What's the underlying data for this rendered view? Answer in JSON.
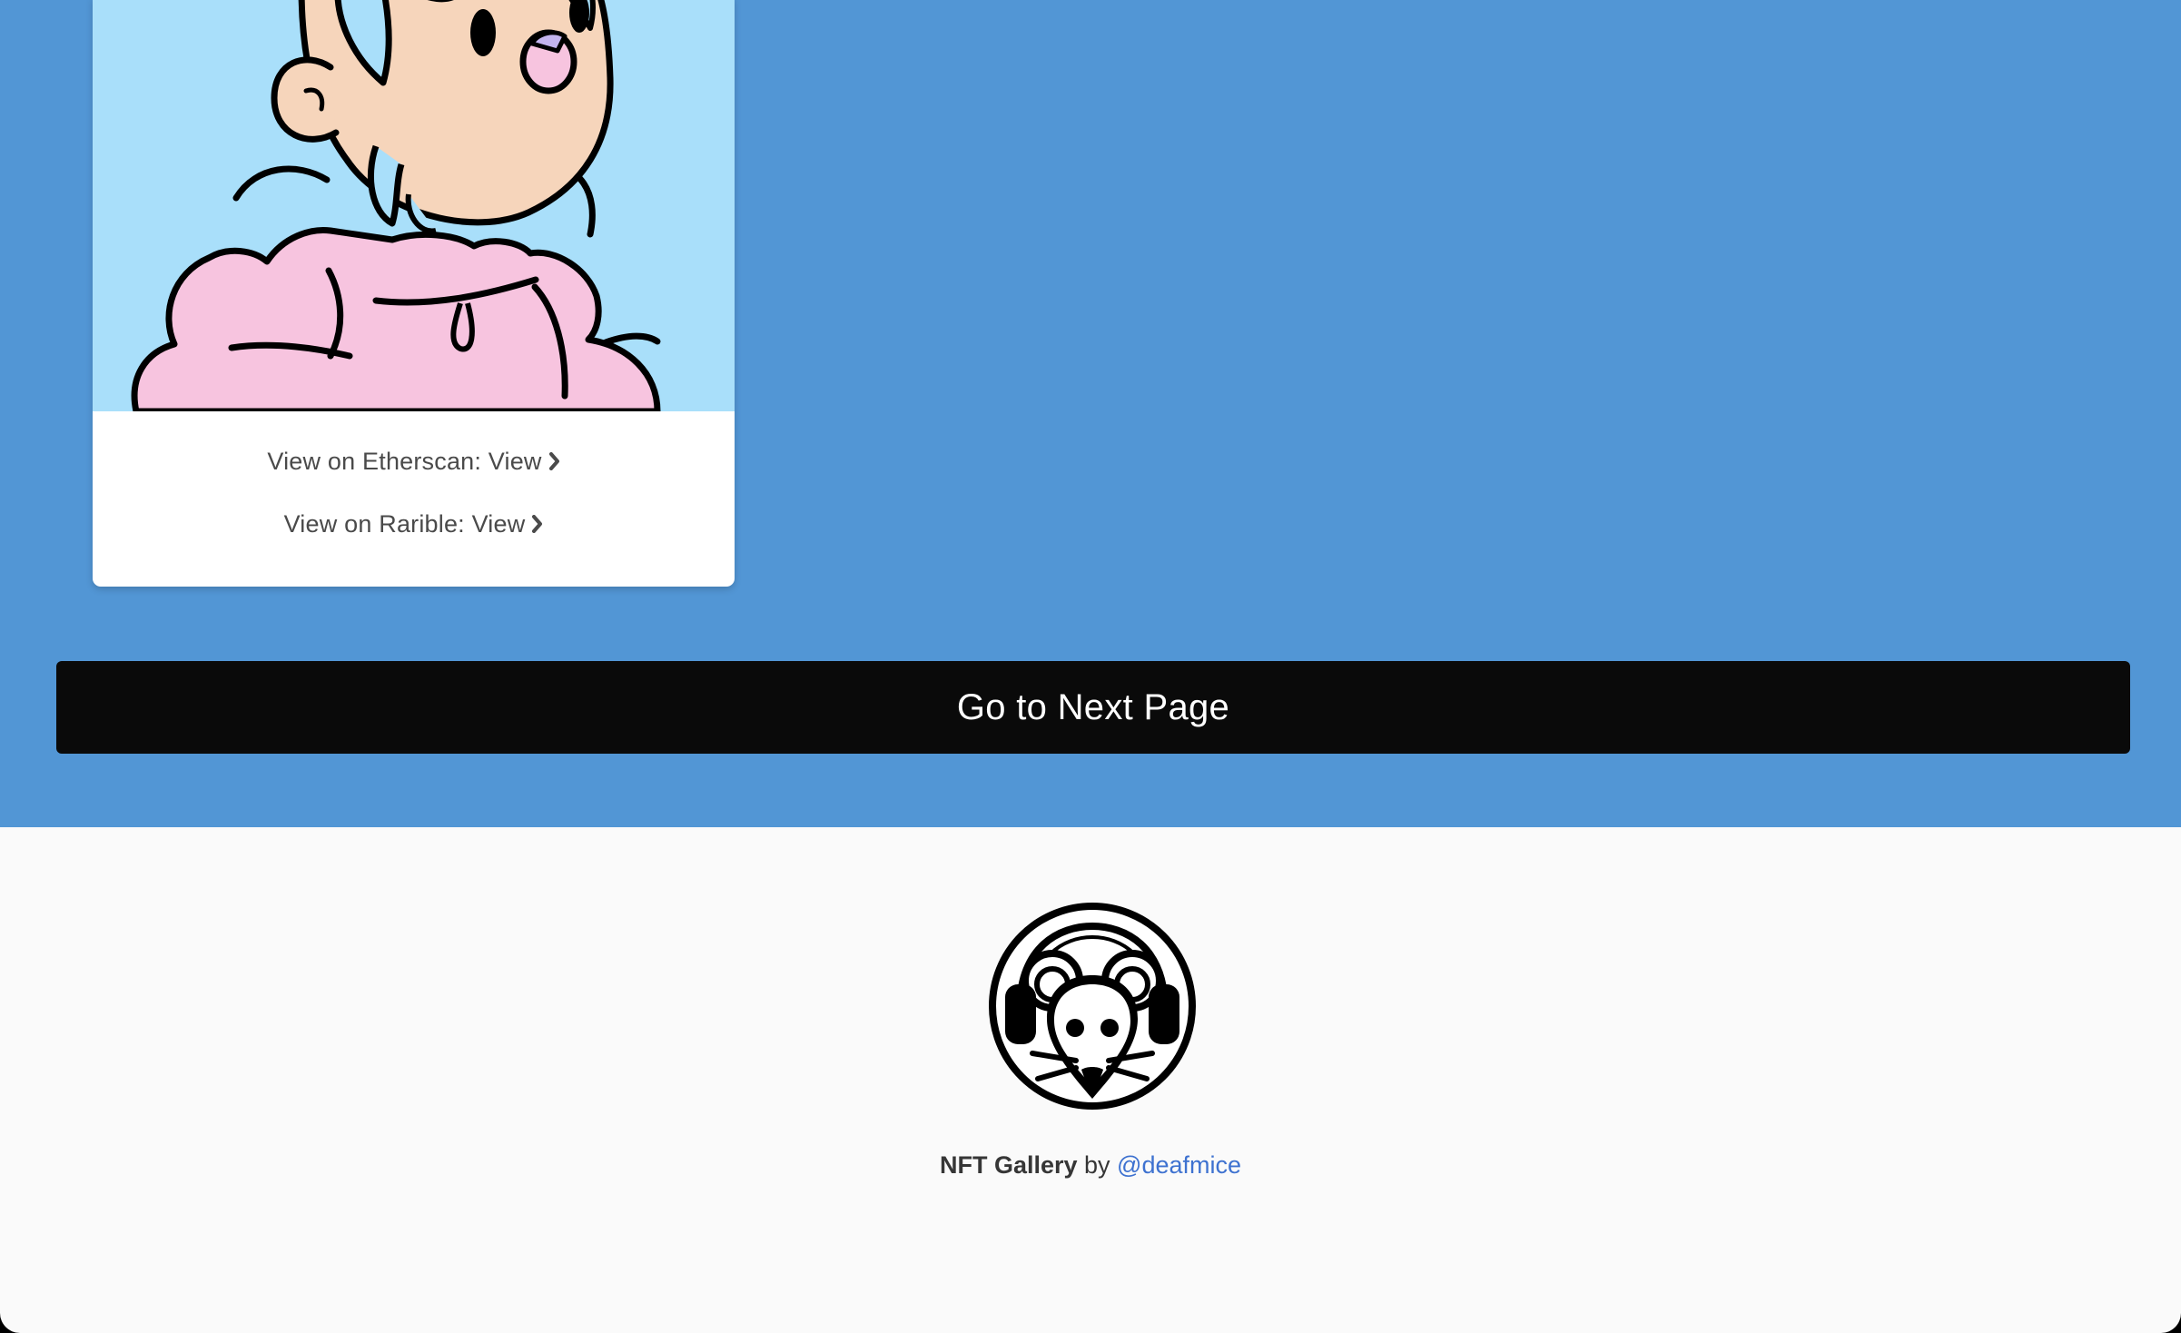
{
  "colors": {
    "section_background": "#5296d5",
    "card_image_background": "#a9dffa",
    "button_background": "#0a0a0a",
    "footer_background": "#fafafa",
    "link_color": "#3e72d0"
  },
  "nft_card": {
    "etherscan_link": "View on Etherscan: View",
    "rarible_link": "View on Rarible: View",
    "chevron_icon": "chevron-right-icon"
  },
  "pagination": {
    "next_page_label": "Go to Next Page"
  },
  "footer": {
    "logo_icon": "mouse-with-headphones-logo",
    "brand": "NFT Gallery",
    "by_text": " by ",
    "author_handle": "@deafmice"
  }
}
